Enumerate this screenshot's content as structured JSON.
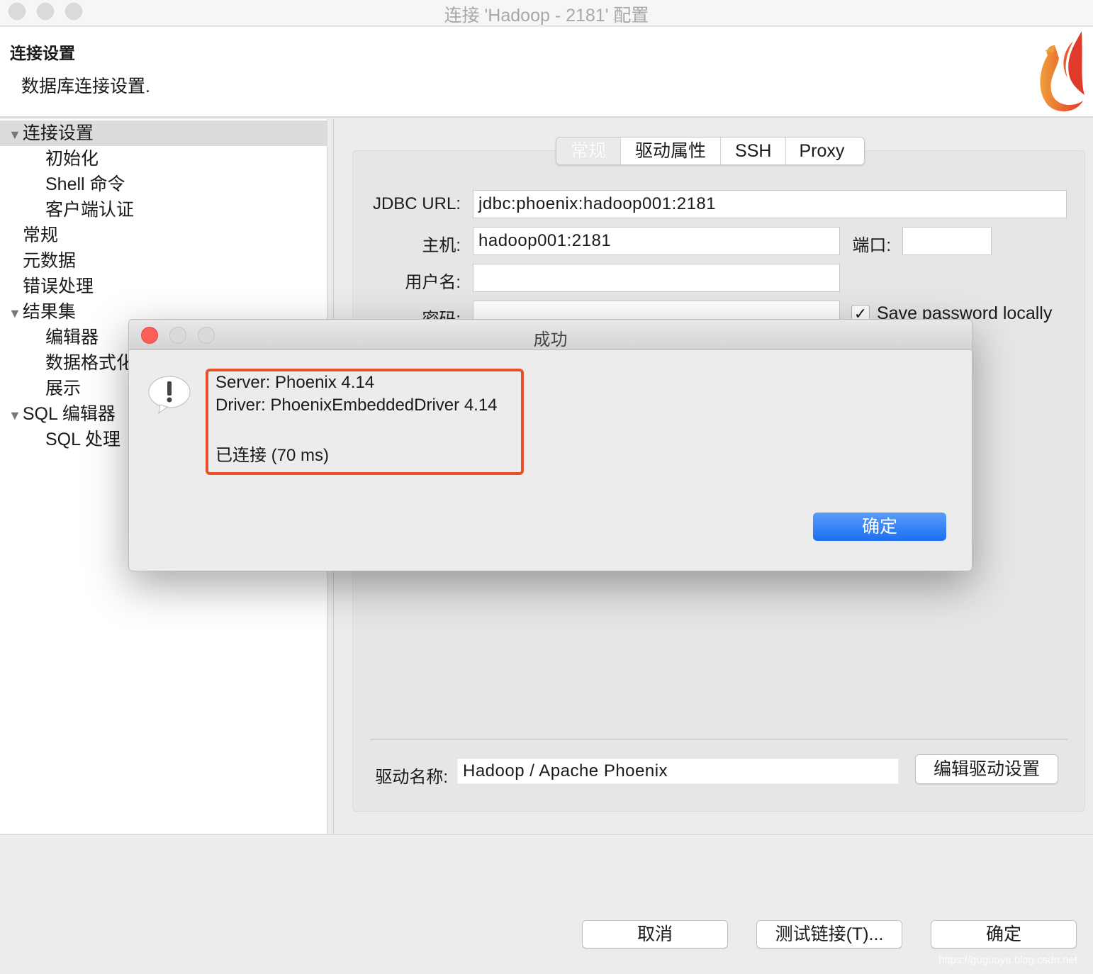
{
  "window": {
    "title": "连接 'Hadoop - 2181' 配置"
  },
  "header": {
    "title": "连接设置",
    "subtitle": "数据库连接设置."
  },
  "sidebar": {
    "items": [
      {
        "label": "连接设置",
        "expanded": true,
        "selected": true
      },
      {
        "label": "初始化"
      },
      {
        "label": "Shell 命令"
      },
      {
        "label": "客户端认证"
      },
      {
        "label": "常规"
      },
      {
        "label": "元数据"
      },
      {
        "label": "错误处理"
      },
      {
        "label": "结果集",
        "expanded": true
      },
      {
        "label": "编辑器"
      },
      {
        "label": "数据格式化"
      },
      {
        "label": "展示"
      },
      {
        "label": "SQL 编辑器",
        "expanded": true
      },
      {
        "label": "SQL 处理"
      }
    ]
  },
  "tabs": [
    {
      "label": "常规",
      "active": true
    },
    {
      "label": "驱动属性"
    },
    {
      "label": "SSH"
    },
    {
      "label": "Proxy"
    }
  ],
  "form": {
    "jdbc_label": "JDBC URL:",
    "jdbc_value": "jdbc:phoenix:hadoop001:2181",
    "host_label": "主机:",
    "host_value": "hadoop001:2181",
    "port_label": "端口:",
    "port_value": "",
    "user_label": "用户名:",
    "user_value": "",
    "password_label": "密码:",
    "password_value": "",
    "save_password_label": "Save password locally",
    "save_password_checked": true,
    "driver_label": "驱动名称:",
    "driver_value": "Hadoop / Apache Phoenix",
    "edit_driver_button": "编辑驱动设置"
  },
  "footer": {
    "cancel": "取消",
    "test": "测试链接(T)...",
    "ok": "确定",
    "watermark": "https://guguoyu.blog.csdn.net"
  },
  "dialog": {
    "title": "成功",
    "server": "Server: Phoenix 4.14",
    "driver": "Driver: PhoenixEmbeddedDriver 4.14",
    "status": "已连接 (70 ms)",
    "ok": "确定",
    "icon": "exclamation-speech-icon",
    "highlight_color": "#e8502a",
    "button_color": "#2f7ef5"
  }
}
